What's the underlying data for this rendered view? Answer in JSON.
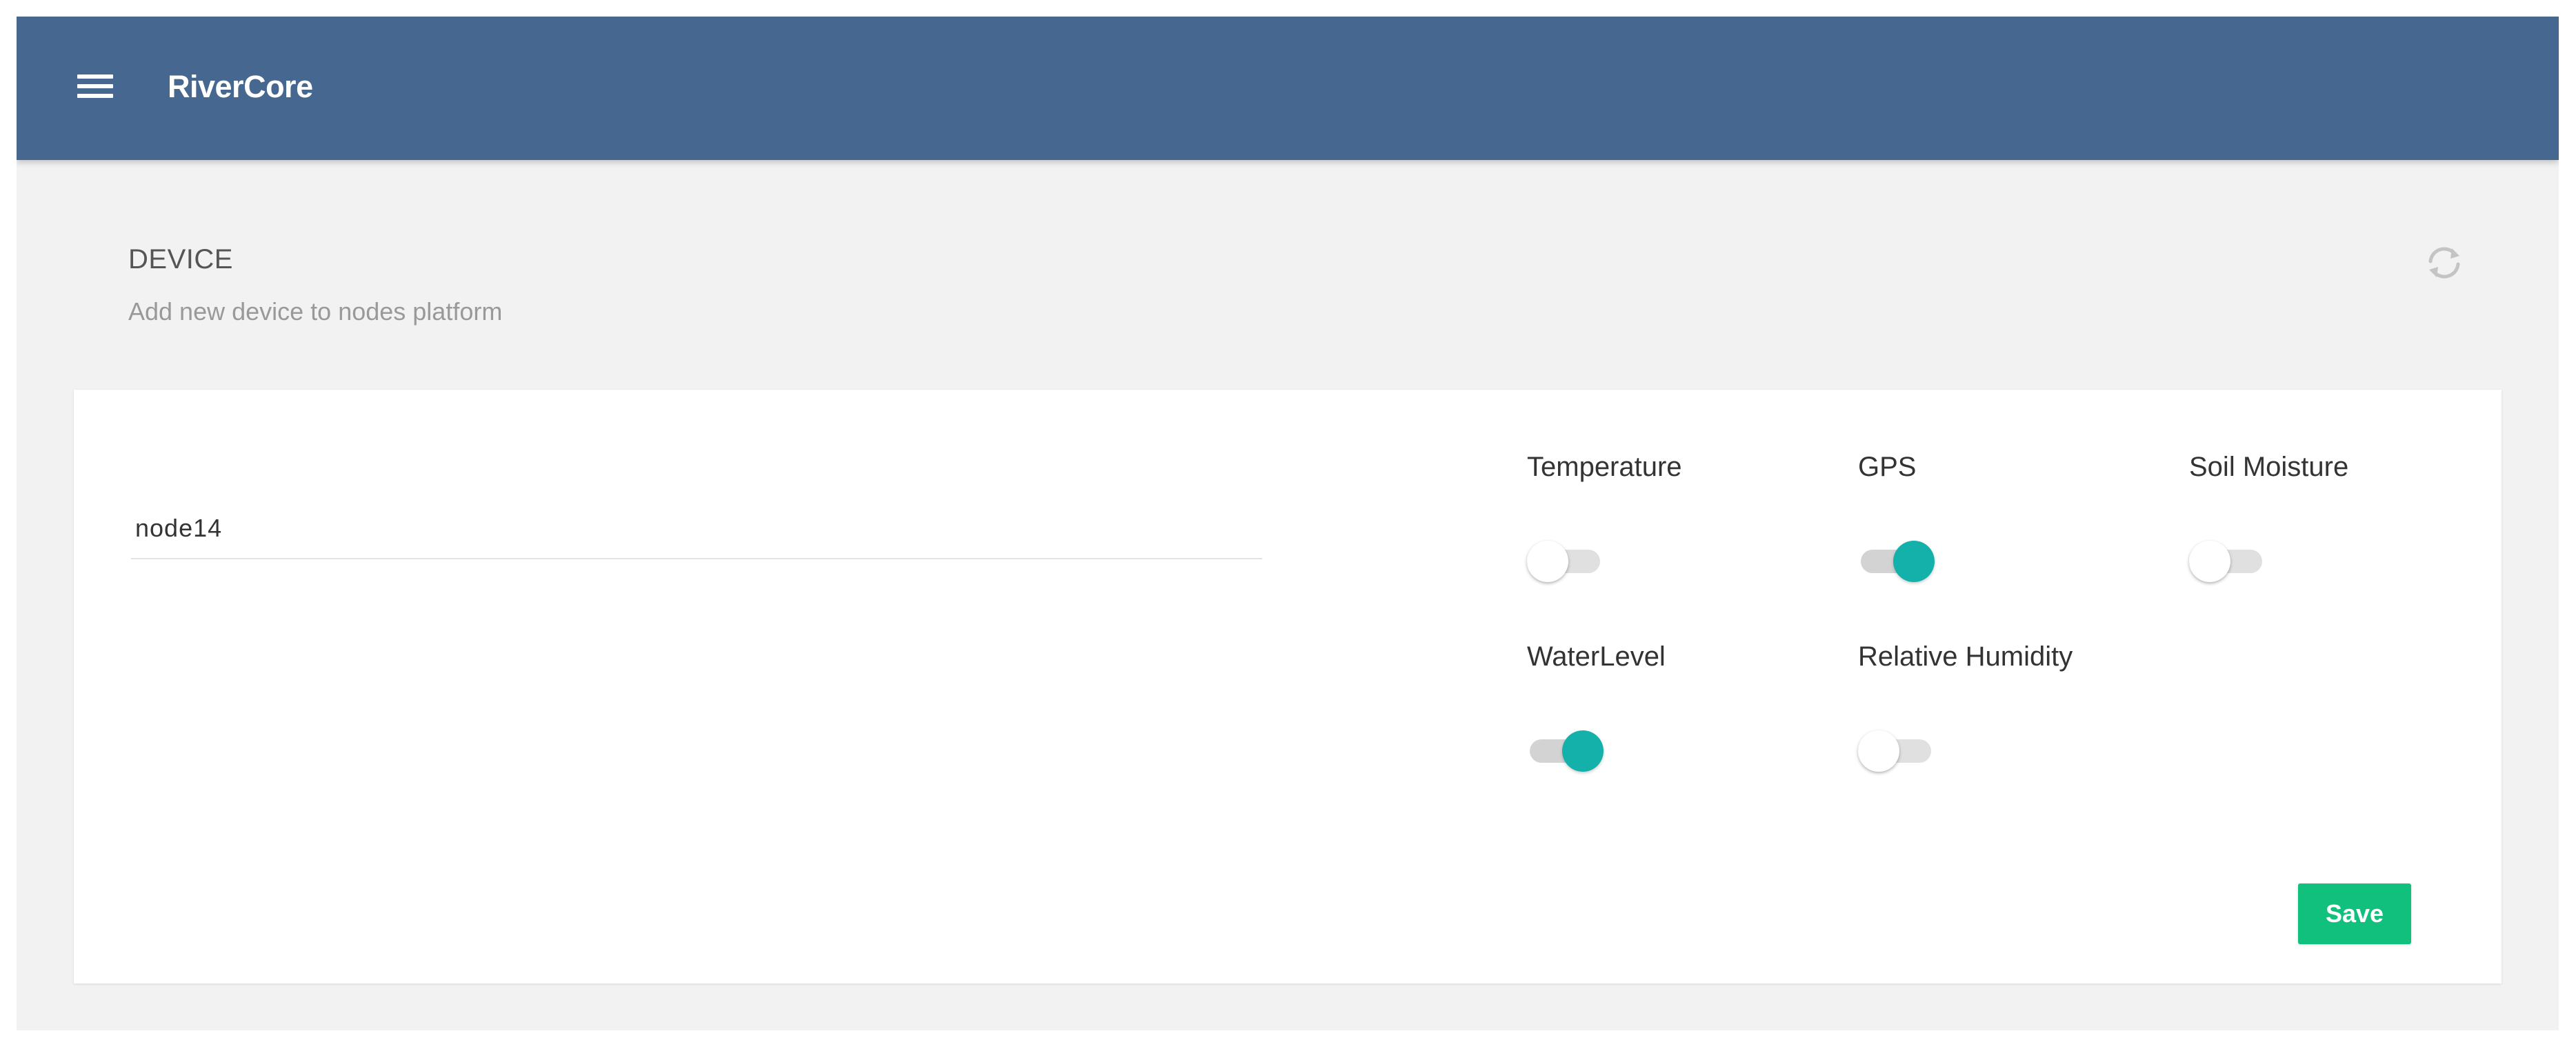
{
  "app": {
    "title": "RiverCore"
  },
  "icons": {
    "menu": "hamburger-menu-icon",
    "refresh": "refresh-icon"
  },
  "page": {
    "title": "DEVICE",
    "subtitle": "Add new device to nodes platform"
  },
  "form": {
    "device_name": "node14",
    "sensors": [
      {
        "label": "Temperature",
        "enabled": false
      },
      {
        "label": "GPS",
        "enabled": true
      },
      {
        "label": "Soil Moisture",
        "enabled": false
      },
      {
        "label": "WaterLevel",
        "enabled": true
      },
      {
        "label": "Relative Humidity",
        "enabled": false
      }
    ],
    "save_label": "Save"
  },
  "colors": {
    "topbar": "#466890",
    "toggle_on": "#14b1ab",
    "save_button": "#11c07d",
    "background": "#f2f2f2"
  }
}
